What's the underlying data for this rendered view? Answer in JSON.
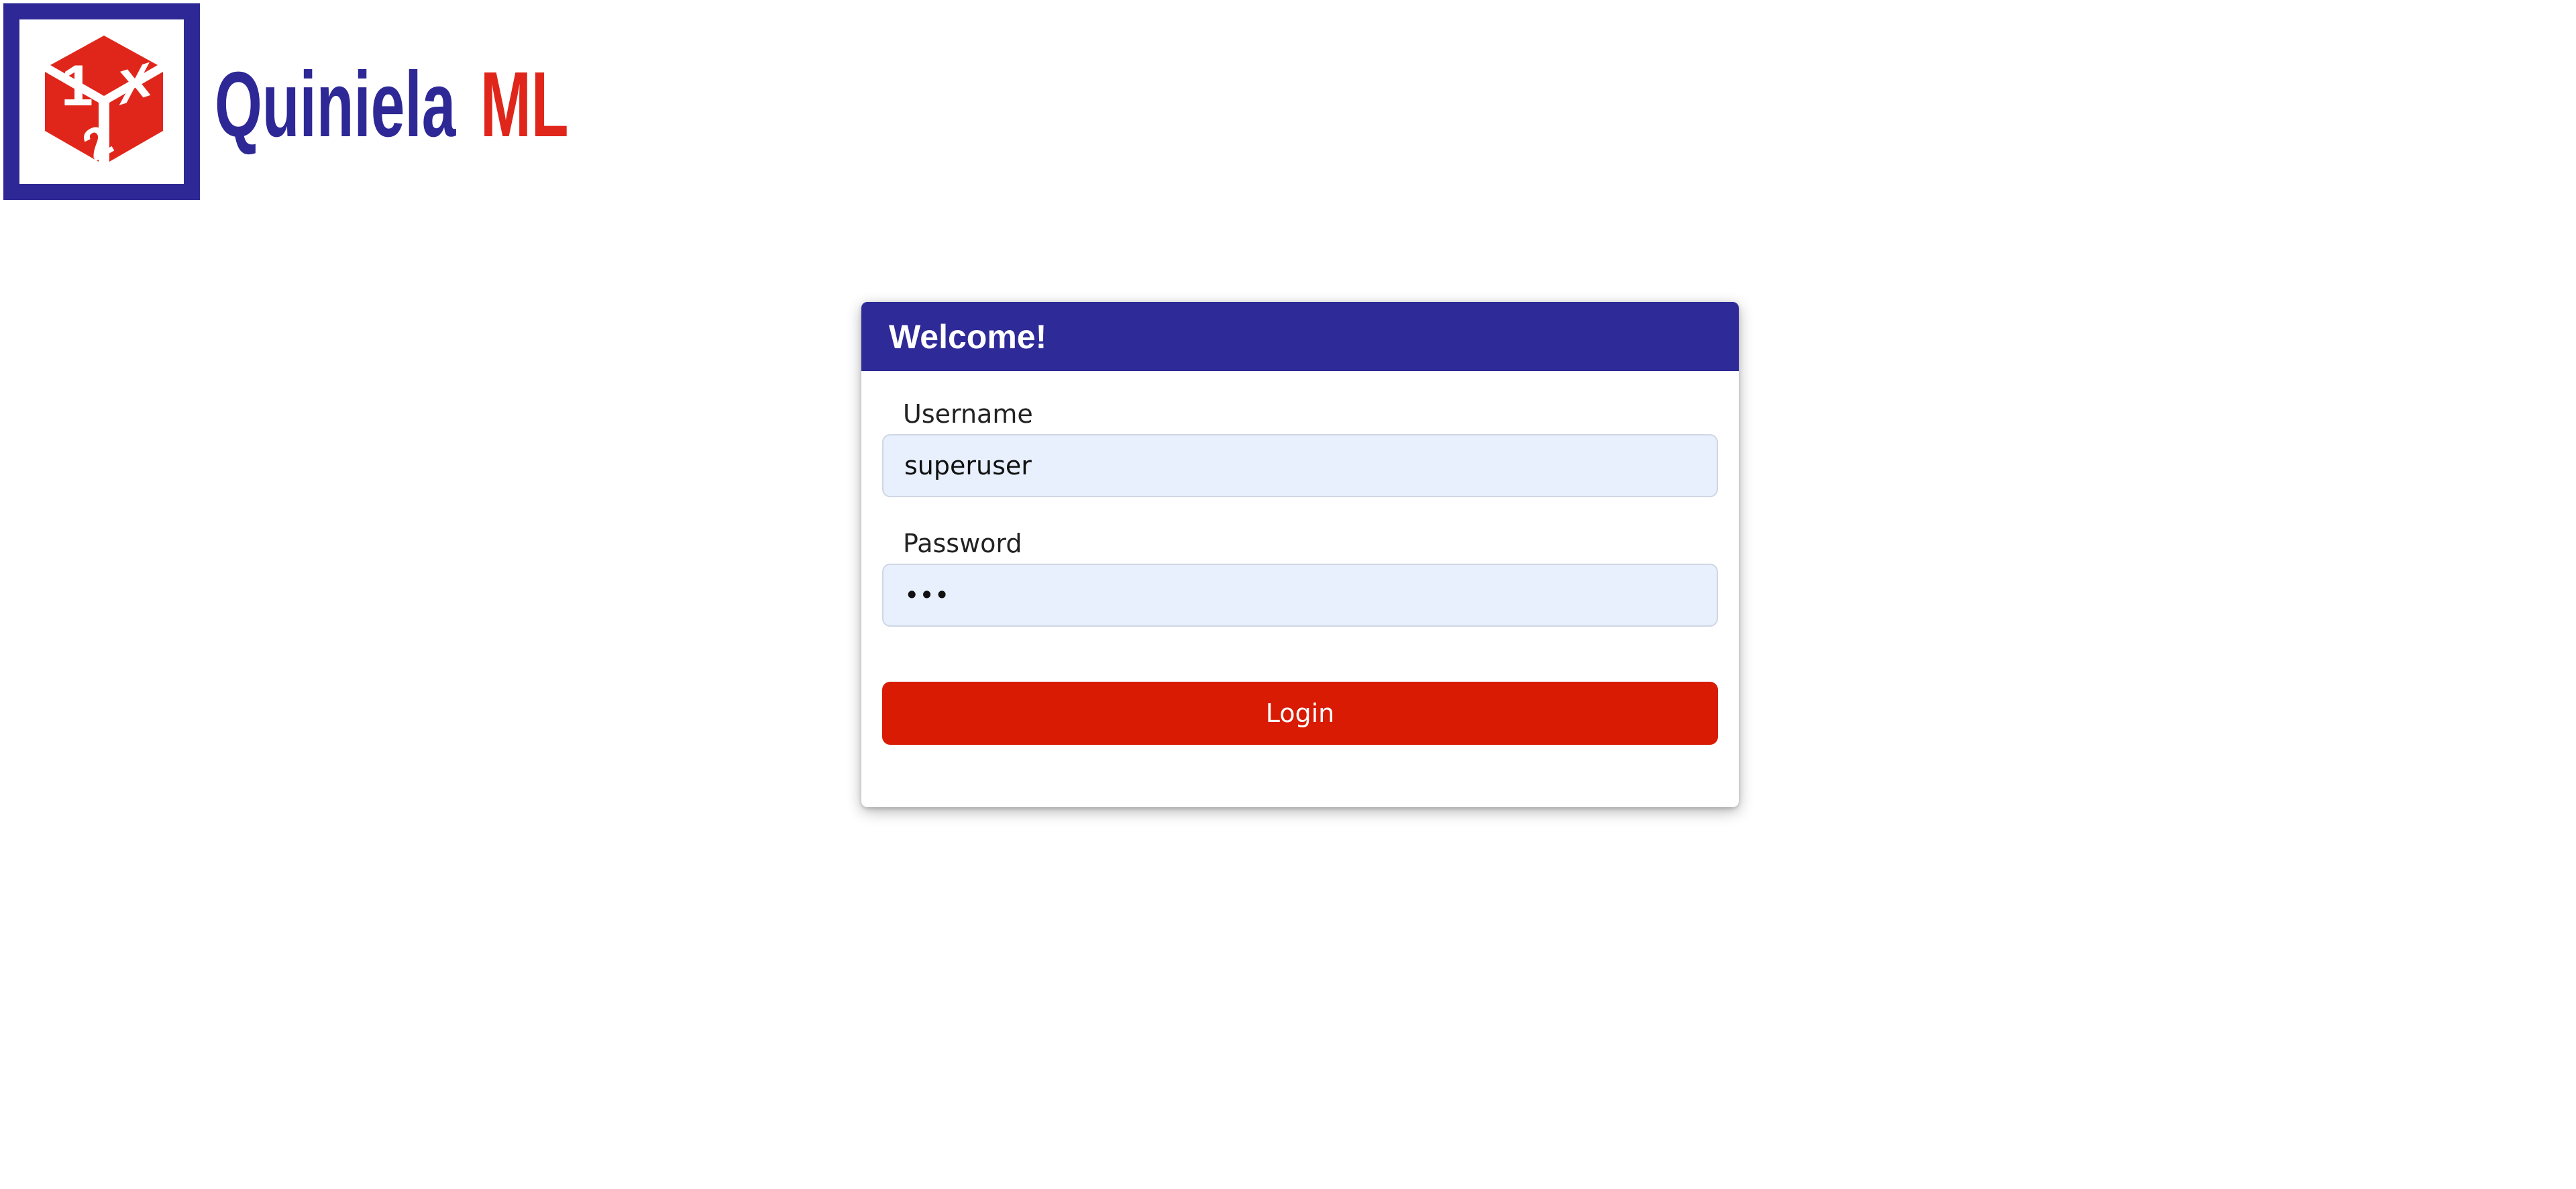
{
  "brand": {
    "logo_text_primary": "Quiniela",
    "logo_text_accent": "ML",
    "logo_cube_faces": [
      "1",
      "X",
      "2"
    ],
    "colors": {
      "primary": "#2e2a97",
      "accent": "#d81b02"
    }
  },
  "login": {
    "title": "Welcome!",
    "username_label": "Username",
    "username_value": "superuser",
    "password_label": "Password",
    "password_value": "123",
    "submit_label": "Login"
  }
}
